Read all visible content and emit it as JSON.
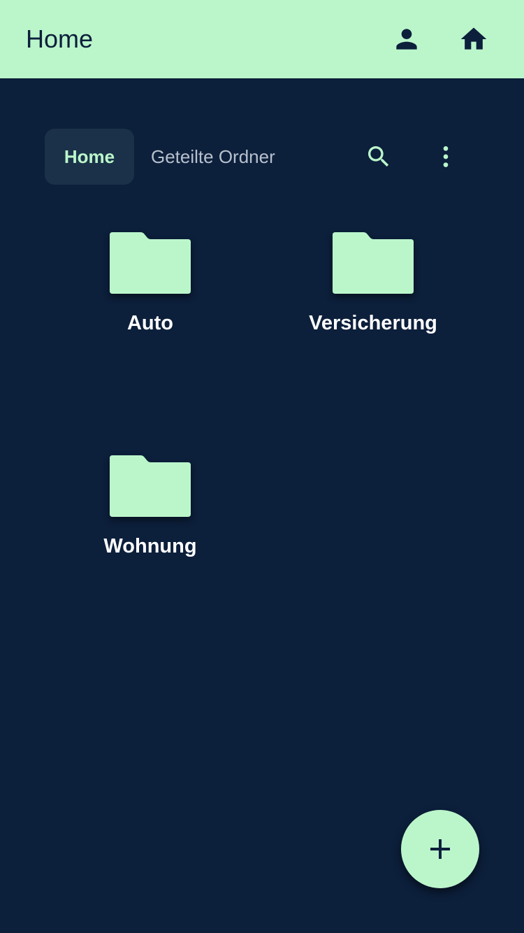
{
  "app_bar": {
    "title": "Home",
    "actions": [
      {
        "icon": "person-icon"
      },
      {
        "icon": "home-icon"
      }
    ]
  },
  "tabs": [
    {
      "label": "Home",
      "selected": true
    },
    {
      "label": "Geteilte Ordner",
      "selected": false
    }
  ],
  "tab_actions": [
    {
      "icon": "search-icon"
    },
    {
      "icon": "more-vertical-icon"
    }
  ],
  "folders": [
    {
      "name": "Auto",
      "icon": "folder-icon"
    },
    {
      "name": "Versicherung",
      "icon": "folder-icon"
    },
    {
      "name": "Wohnung",
      "icon": "folder-icon"
    }
  ],
  "fab": {
    "icon": "plus-icon"
  },
  "colors": {
    "background": "#0c1f3b",
    "accent": "#bbf6cb",
    "tab_selected_bg": "#1b3149",
    "tab_inactive_text": "#b7c0cd",
    "text_light": "#ffffff"
  }
}
